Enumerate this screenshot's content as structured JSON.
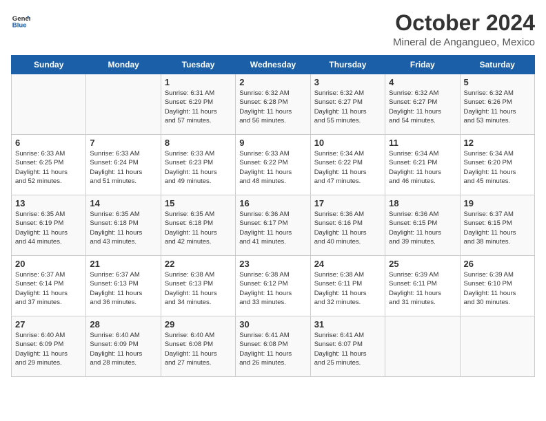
{
  "header": {
    "logo_line1": "General",
    "logo_line2": "Blue",
    "title": "October 2024",
    "subtitle": "Mineral de Angangueo, Mexico"
  },
  "weekdays": [
    "Sunday",
    "Monday",
    "Tuesday",
    "Wednesday",
    "Thursday",
    "Friday",
    "Saturday"
  ],
  "weeks": [
    [
      {
        "day": "",
        "info": ""
      },
      {
        "day": "",
        "info": ""
      },
      {
        "day": "1",
        "info": "Sunrise: 6:31 AM\nSunset: 6:29 PM\nDaylight: 11 hours\nand 57 minutes."
      },
      {
        "day": "2",
        "info": "Sunrise: 6:32 AM\nSunset: 6:28 PM\nDaylight: 11 hours\nand 56 minutes."
      },
      {
        "day": "3",
        "info": "Sunrise: 6:32 AM\nSunset: 6:27 PM\nDaylight: 11 hours\nand 55 minutes."
      },
      {
        "day": "4",
        "info": "Sunrise: 6:32 AM\nSunset: 6:27 PM\nDaylight: 11 hours\nand 54 minutes."
      },
      {
        "day": "5",
        "info": "Sunrise: 6:32 AM\nSunset: 6:26 PM\nDaylight: 11 hours\nand 53 minutes."
      }
    ],
    [
      {
        "day": "6",
        "info": "Sunrise: 6:33 AM\nSunset: 6:25 PM\nDaylight: 11 hours\nand 52 minutes."
      },
      {
        "day": "7",
        "info": "Sunrise: 6:33 AM\nSunset: 6:24 PM\nDaylight: 11 hours\nand 51 minutes."
      },
      {
        "day": "8",
        "info": "Sunrise: 6:33 AM\nSunset: 6:23 PM\nDaylight: 11 hours\nand 49 minutes."
      },
      {
        "day": "9",
        "info": "Sunrise: 6:33 AM\nSunset: 6:22 PM\nDaylight: 11 hours\nand 48 minutes."
      },
      {
        "day": "10",
        "info": "Sunrise: 6:34 AM\nSunset: 6:22 PM\nDaylight: 11 hours\nand 47 minutes."
      },
      {
        "day": "11",
        "info": "Sunrise: 6:34 AM\nSunset: 6:21 PM\nDaylight: 11 hours\nand 46 minutes."
      },
      {
        "day": "12",
        "info": "Sunrise: 6:34 AM\nSunset: 6:20 PM\nDaylight: 11 hours\nand 45 minutes."
      }
    ],
    [
      {
        "day": "13",
        "info": "Sunrise: 6:35 AM\nSunset: 6:19 PM\nDaylight: 11 hours\nand 44 minutes."
      },
      {
        "day": "14",
        "info": "Sunrise: 6:35 AM\nSunset: 6:18 PM\nDaylight: 11 hours\nand 43 minutes."
      },
      {
        "day": "15",
        "info": "Sunrise: 6:35 AM\nSunset: 6:18 PM\nDaylight: 11 hours\nand 42 minutes."
      },
      {
        "day": "16",
        "info": "Sunrise: 6:36 AM\nSunset: 6:17 PM\nDaylight: 11 hours\nand 41 minutes."
      },
      {
        "day": "17",
        "info": "Sunrise: 6:36 AM\nSunset: 6:16 PM\nDaylight: 11 hours\nand 40 minutes."
      },
      {
        "day": "18",
        "info": "Sunrise: 6:36 AM\nSunset: 6:15 PM\nDaylight: 11 hours\nand 39 minutes."
      },
      {
        "day": "19",
        "info": "Sunrise: 6:37 AM\nSunset: 6:15 PM\nDaylight: 11 hours\nand 38 minutes."
      }
    ],
    [
      {
        "day": "20",
        "info": "Sunrise: 6:37 AM\nSunset: 6:14 PM\nDaylight: 11 hours\nand 37 minutes."
      },
      {
        "day": "21",
        "info": "Sunrise: 6:37 AM\nSunset: 6:13 PM\nDaylight: 11 hours\nand 36 minutes."
      },
      {
        "day": "22",
        "info": "Sunrise: 6:38 AM\nSunset: 6:13 PM\nDaylight: 11 hours\nand 34 minutes."
      },
      {
        "day": "23",
        "info": "Sunrise: 6:38 AM\nSunset: 6:12 PM\nDaylight: 11 hours\nand 33 minutes."
      },
      {
        "day": "24",
        "info": "Sunrise: 6:38 AM\nSunset: 6:11 PM\nDaylight: 11 hours\nand 32 minutes."
      },
      {
        "day": "25",
        "info": "Sunrise: 6:39 AM\nSunset: 6:11 PM\nDaylight: 11 hours\nand 31 minutes."
      },
      {
        "day": "26",
        "info": "Sunrise: 6:39 AM\nSunset: 6:10 PM\nDaylight: 11 hours\nand 30 minutes."
      }
    ],
    [
      {
        "day": "27",
        "info": "Sunrise: 6:40 AM\nSunset: 6:09 PM\nDaylight: 11 hours\nand 29 minutes."
      },
      {
        "day": "28",
        "info": "Sunrise: 6:40 AM\nSunset: 6:09 PM\nDaylight: 11 hours\nand 28 minutes."
      },
      {
        "day": "29",
        "info": "Sunrise: 6:40 AM\nSunset: 6:08 PM\nDaylight: 11 hours\nand 27 minutes."
      },
      {
        "day": "30",
        "info": "Sunrise: 6:41 AM\nSunset: 6:08 PM\nDaylight: 11 hours\nand 26 minutes."
      },
      {
        "day": "31",
        "info": "Sunrise: 6:41 AM\nSunset: 6:07 PM\nDaylight: 11 hours\nand 25 minutes."
      },
      {
        "day": "",
        "info": ""
      },
      {
        "day": "",
        "info": ""
      }
    ]
  ]
}
